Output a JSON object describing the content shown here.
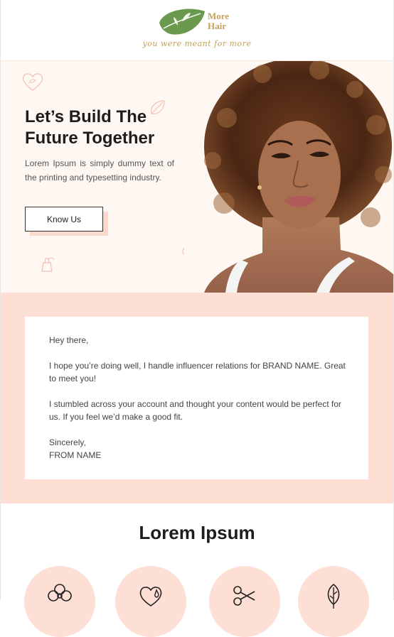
{
  "brand": {
    "name_line1": "More",
    "name_line2": "Hair",
    "tagline": "you were meant for more",
    "accent_gold": "#c3a15b",
    "leaf_green": "#6b9a4e"
  },
  "hero": {
    "title_line1": "Let’s Build The",
    "title_line2": "Future Together",
    "body": "Lorem Ipsum is simply dummy text of the printing and typesetting industry.",
    "button_label": "Know Us",
    "background": "#fff7f1"
  },
  "letter": {
    "greeting": "Hey there,",
    "paragraph1": "I hope you’re doing well, I handle influencer relations for BRAND NAME. Great to meet you!",
    "paragraph2": "I stumbled across your account and thought your content would be perfect for us. If you feel we’d make a good fit.",
    "signoff": "Sincerely,",
    "from": "FROM NAME",
    "background": "#fddfd5"
  },
  "features": {
    "title": "Lorem Ipsum",
    "icons": [
      "flower-icon",
      "heart-drop-icon",
      "scissors-icon",
      "leaf-icon"
    ]
  }
}
